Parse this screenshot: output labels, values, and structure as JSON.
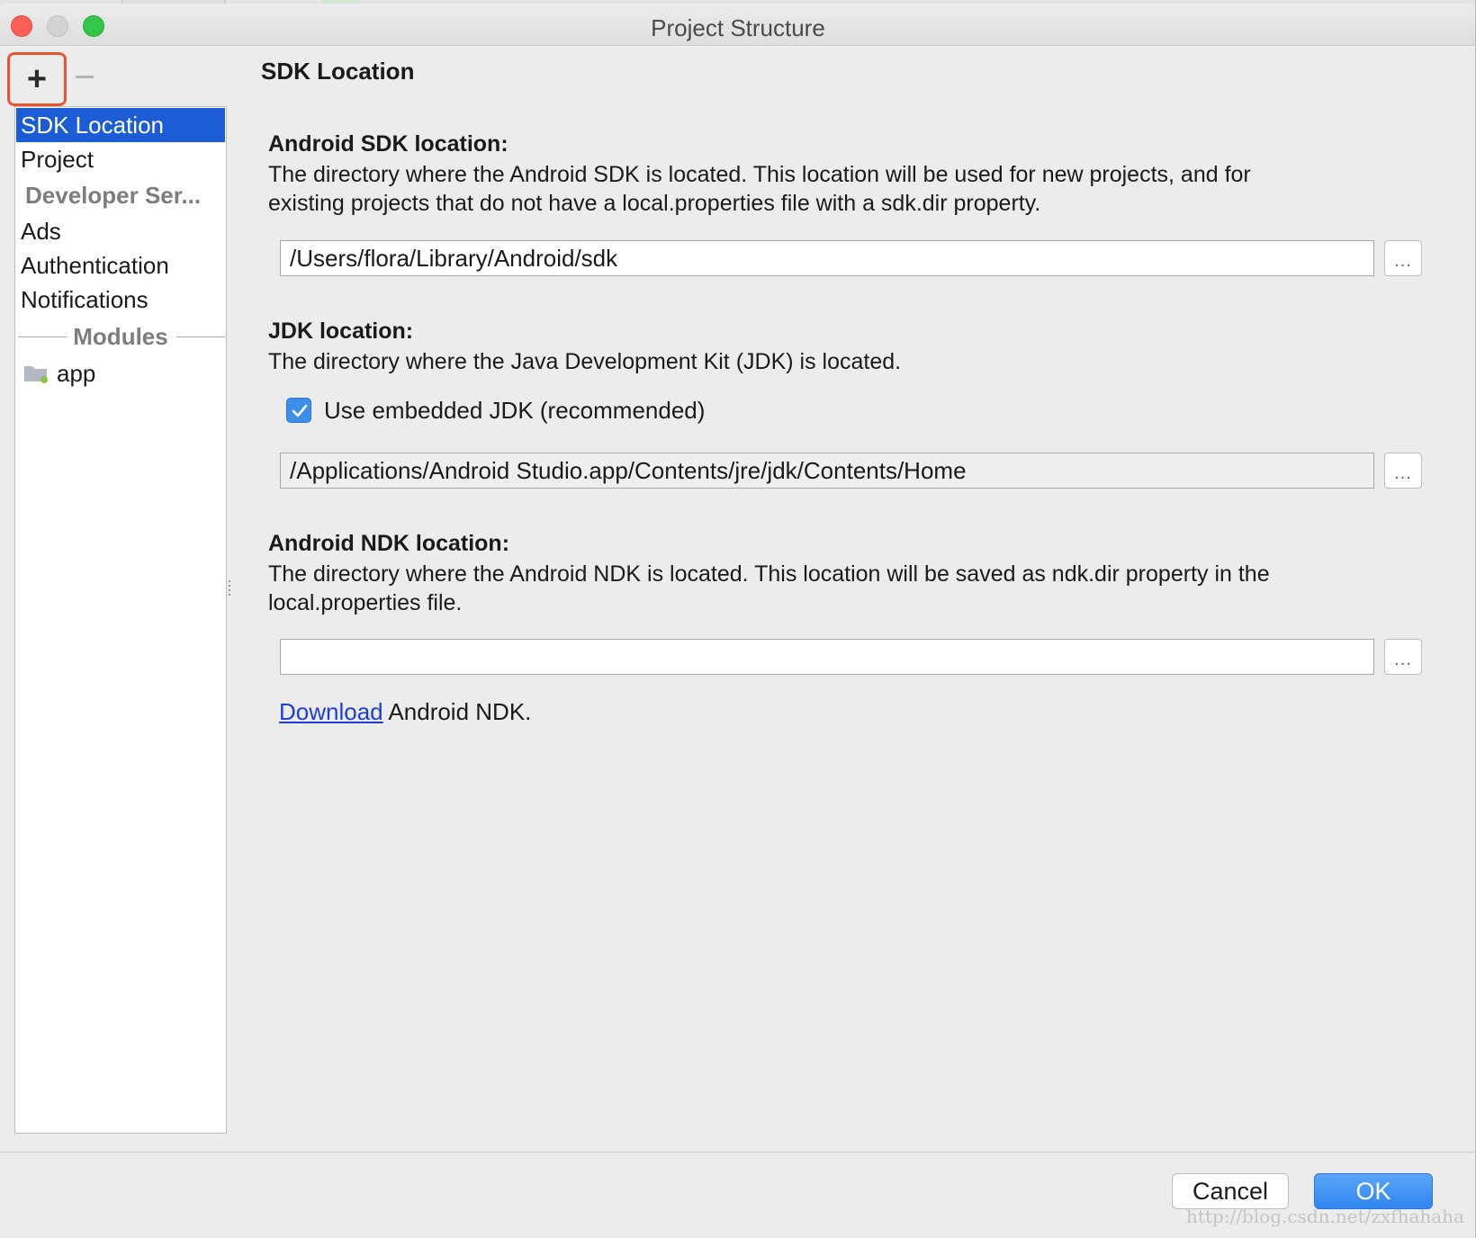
{
  "window": {
    "title": "Project Structure"
  },
  "toolbar": {
    "add_label": "+",
    "remove_label": "—"
  },
  "sidebar": {
    "items": [
      {
        "label": "SDK Location",
        "selected": true
      },
      {
        "label": "Project",
        "selected": false
      }
    ],
    "developer_services_header": "Developer Ser...",
    "developer_services_items": [
      {
        "label": "Ads"
      },
      {
        "label": "Authentication"
      },
      {
        "label": "Notifications"
      }
    ],
    "modules_header": "Modules",
    "modules": [
      {
        "label": "app",
        "icon": "module-folder-icon"
      }
    ]
  },
  "main": {
    "page_title": "SDK Location",
    "sdk": {
      "heading": "Android SDK location:",
      "description_line1": "The directory where the Android SDK is located. This location will be used for new projects, and for",
      "description_line2": "existing projects that do not have a local.properties file with a sdk.dir property.",
      "path": "/Users/flora/Library/Android/sdk",
      "browse_label": "..."
    },
    "jdk": {
      "heading": "JDK location:",
      "description": "The directory where the Java Development Kit (JDK) is located.",
      "use_embedded_label": "Use embedded JDK (recommended)",
      "use_embedded_checked": true,
      "path": "/Applications/Android Studio.app/Contents/jre/jdk/Contents/Home",
      "browse_label": "..."
    },
    "ndk": {
      "heading": "Android NDK location:",
      "description_line1": "The directory where the Android NDK is located. This location will be saved as ndk.dir property in the",
      "description_line2": "local.properties file.",
      "path": "",
      "browse_label": "...",
      "download_link": "Download",
      "download_suffix": " Android NDK."
    }
  },
  "buttons": {
    "cancel": "Cancel",
    "ok": "OK"
  },
  "watermark": "http://blog.csdn.net/zxfhahaha",
  "colors": {
    "selection": "#1c5cd4",
    "accent": "#2f85f0",
    "highlight_box": "#e8552f",
    "link": "#1b3ed8"
  }
}
